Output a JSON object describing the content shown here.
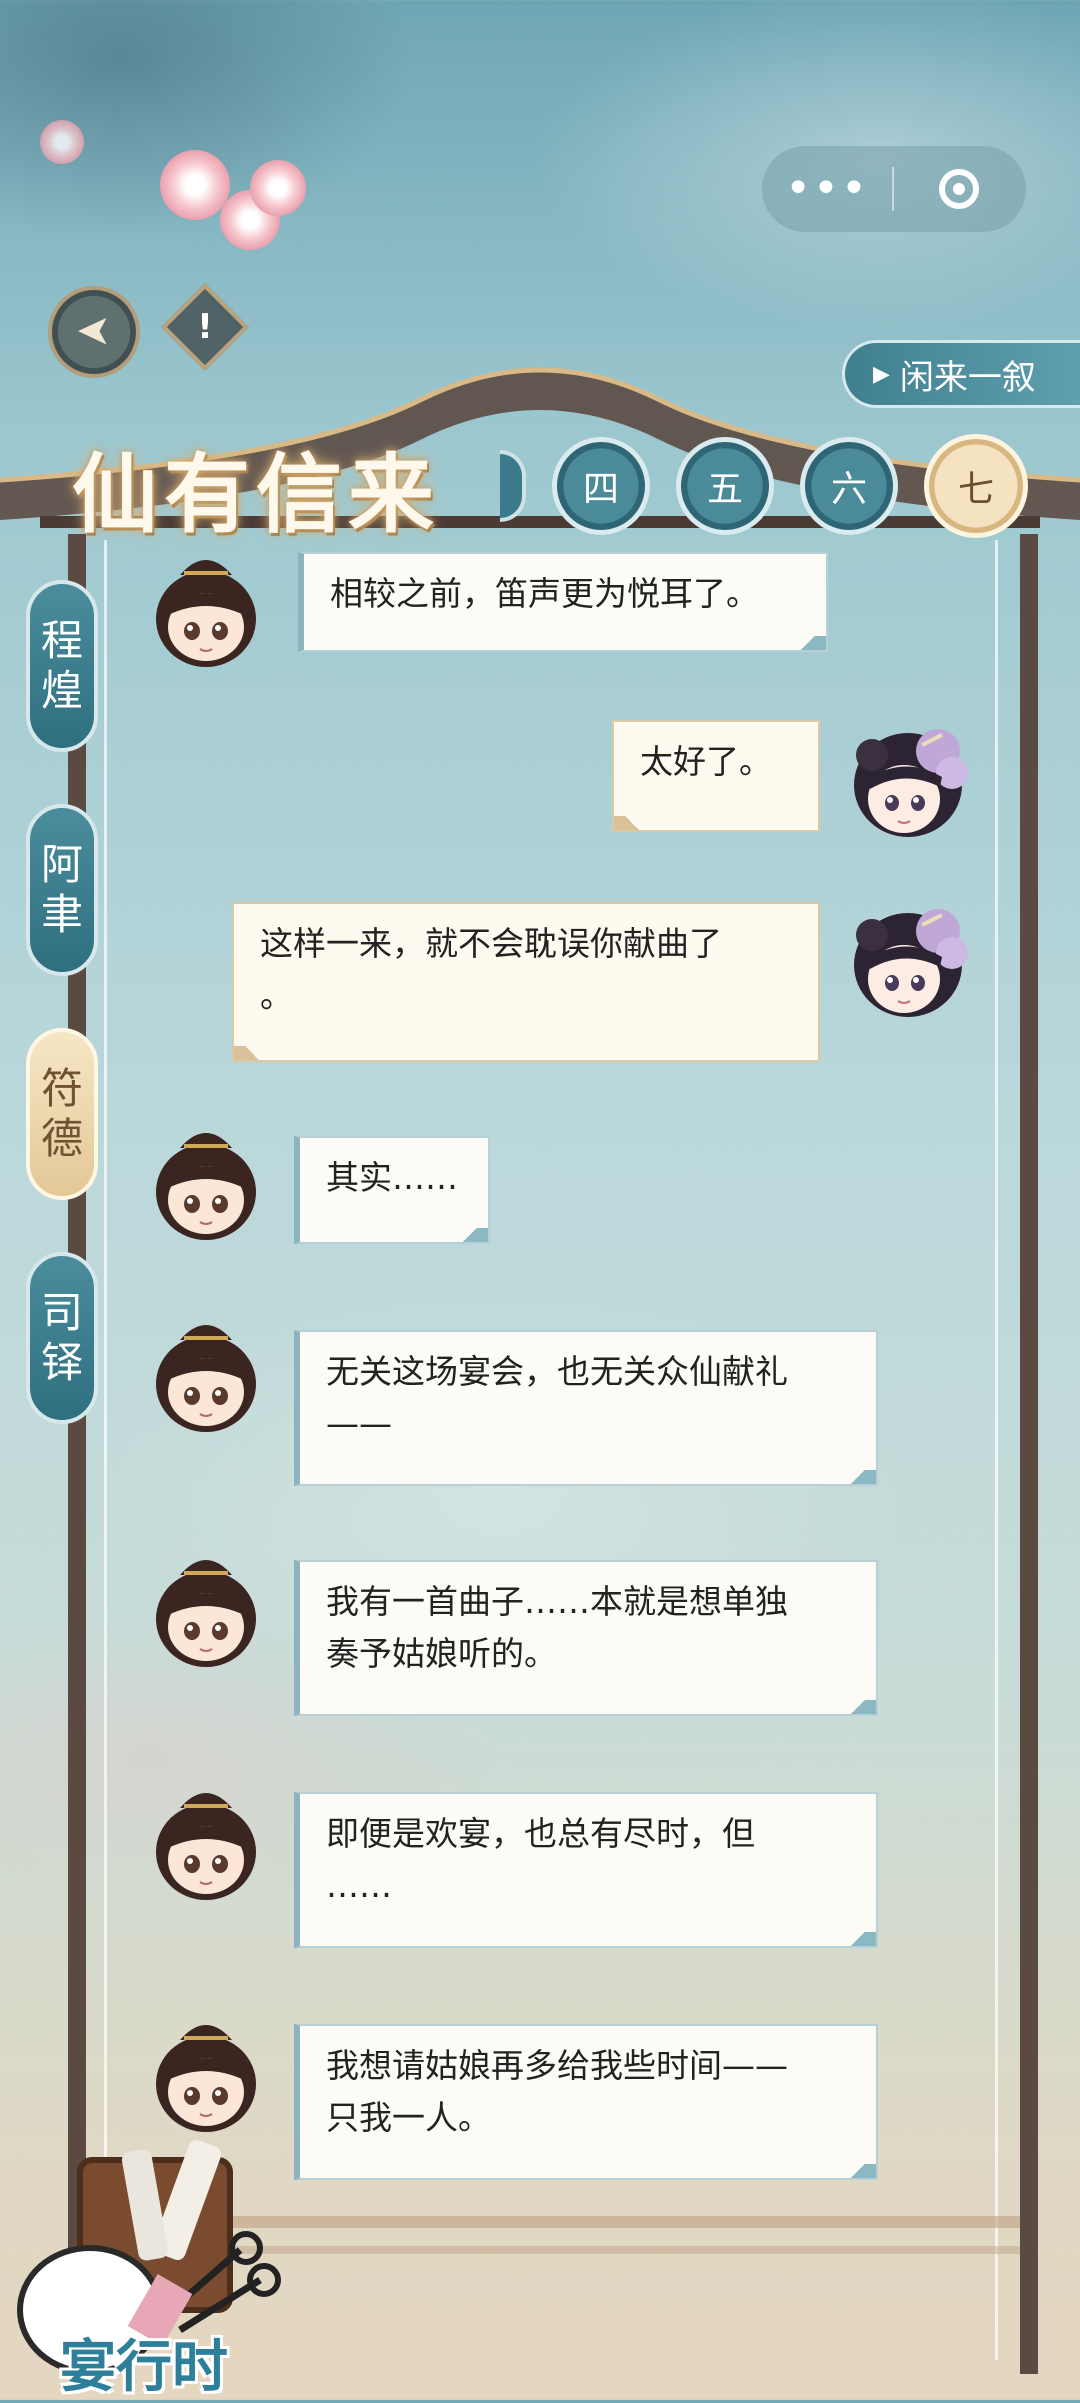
{
  "capsule": {
    "more_icon": "more-dots-icon",
    "close_icon": "target-circle-icon",
    "more_label": "•••"
  },
  "header": {
    "back_icon": "back-arrow-icon",
    "back_glyph": "➤",
    "info_glyph": "!",
    "title": "仙有信来",
    "chat_button": "闲来一叙",
    "chapters": [
      "四",
      "五",
      "六",
      "七"
    ],
    "active_chapter": "七"
  },
  "sidebar": {
    "tabs": [
      {
        "label": [
          "程",
          "煌"
        ],
        "active": false
      },
      {
        "label": [
          "阿",
          "聿"
        ],
        "active": false
      },
      {
        "label": [
          "符",
          "德"
        ],
        "active": true
      },
      {
        "label": [
          "司",
          "铎"
        ],
        "active": false
      }
    ]
  },
  "messages": [
    {
      "side": "left",
      "speaker": "male",
      "lines": [
        "相较之前，笛声更为悦耳了。"
      ]
    },
    {
      "side": "right",
      "speaker": "player",
      "lines": [
        "太好了。"
      ]
    },
    {
      "side": "right",
      "speaker": "player",
      "lines": [
        "这样一来，就不会耽误你献曲了",
        "。"
      ]
    },
    {
      "side": "left",
      "speaker": "male",
      "lines": [
        "其实……"
      ]
    },
    {
      "side": "left",
      "speaker": "male",
      "lines": [
        "无关这场宴会，也无关众仙献礼",
        "——"
      ]
    },
    {
      "side": "left",
      "speaker": "male",
      "lines": [
        "我有一首曲子……本就是想单独",
        "奏予姑娘听的。"
      ]
    },
    {
      "side": "left",
      "speaker": "male",
      "lines": [
        "即便是欢宴，也总有尽时，但",
        "……"
      ]
    },
    {
      "side": "left",
      "speaker": "male",
      "lines": [
        "我想请姑娘再多给我些时间——",
        "只我一人。"
      ]
    }
  ],
  "footer": {
    "label": "宴行时",
    "icon": "sewing-basket-icon"
  },
  "colors": {
    "teal": "#3b7a8a",
    "gold": "#d8b67f",
    "frame": "#5b4a42"
  }
}
